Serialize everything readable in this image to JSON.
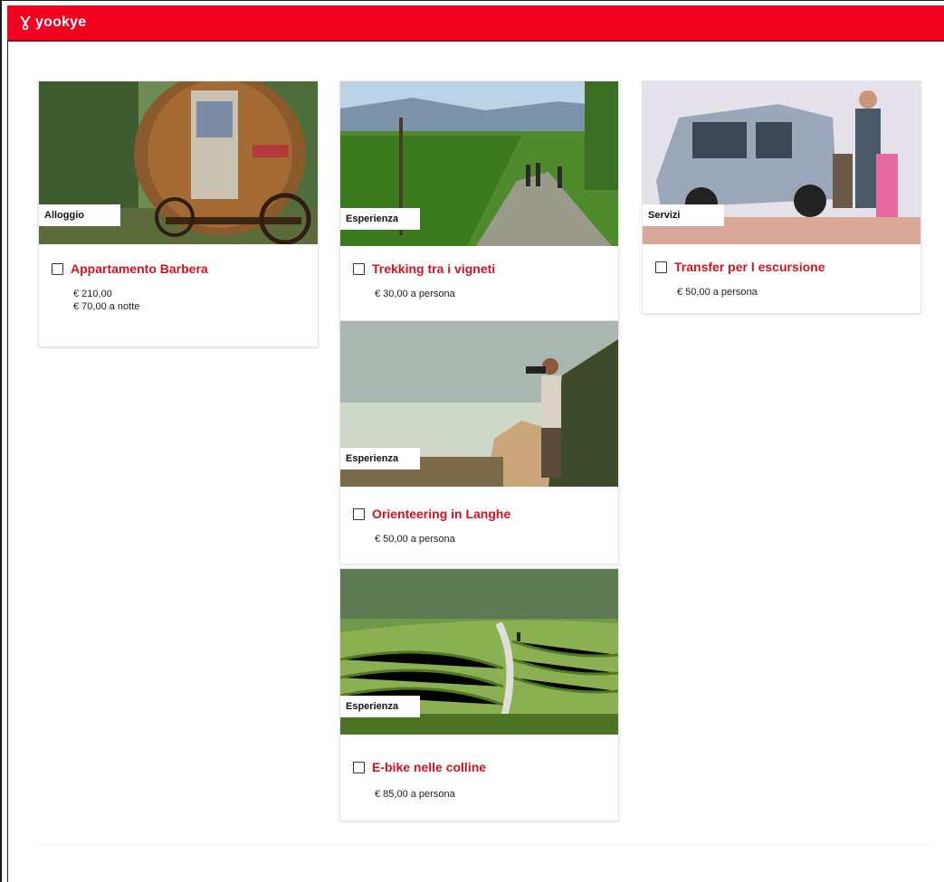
{
  "brand": {
    "name": "yookye",
    "color": "#f2001f"
  },
  "accent_title_color": "#d3131f",
  "cards": [
    {
      "category": "Alloggio",
      "title": "Appartamento Barbera",
      "price_line1": "€ 210,00",
      "price_line2": "€ 70,00 a notte"
    },
    {
      "category": "Esperienza",
      "title": "Trekking tra i vigneti",
      "price_line1": "€ 30,00 a persona"
    },
    {
      "category": "Servizi",
      "title": "Transfer per l escursione",
      "price_line1": "€ 50,00 a persona"
    },
    {
      "category": "Esperienza",
      "title": "Orienteering in Langhe",
      "price_line1": "€ 50,00 a persona"
    },
    {
      "category": "Esperienza",
      "title": "E-bike nelle colline",
      "price_line1": "€ 85,00 a persona"
    }
  ]
}
